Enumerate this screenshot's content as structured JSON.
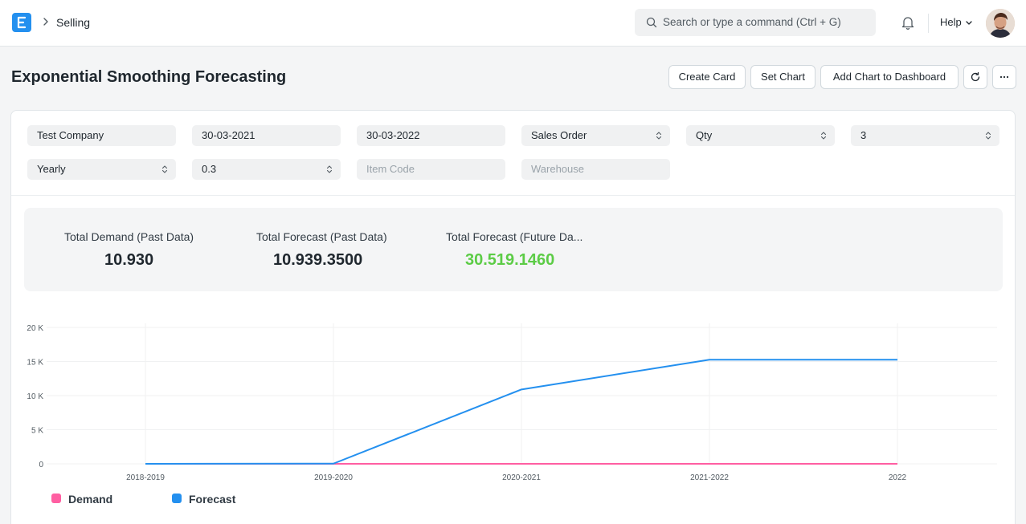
{
  "navbar": {
    "breadcrumb": "Selling",
    "search_placeholder": "Search or type a command (Ctrl + G)",
    "help_label": "Help"
  },
  "page": {
    "title": "Exponential Smoothing Forecasting"
  },
  "actions": {
    "create_card": "Create Card",
    "set_chart": "Set Chart",
    "add_to_dashboard": "Add Chart to Dashboard"
  },
  "filters": {
    "company": "Test Company",
    "from_date": "30-03-2021",
    "to_date": "30-03-2022",
    "based_on_document": "Sales Order",
    "based_on_field": "Qty",
    "no_of_years": "3",
    "periodicity": "Yearly",
    "smoothing_constant": "0.3",
    "item_code_placeholder": "Item Code",
    "warehouse_placeholder": "Warehouse"
  },
  "summary": [
    {
      "label": "Total Demand (Past Data)",
      "value": "10.930",
      "color": "#1f272e"
    },
    {
      "label": "Total Forecast (Past Data)",
      "value": "10.939.3500",
      "color": "#1f272e"
    },
    {
      "label": "Total Forecast (Future Da...",
      "value": "30.519.1460",
      "color": "#5ccc46"
    }
  ],
  "chart_data": {
    "type": "line",
    "categories": [
      "2018-2019",
      "2019-2020",
      "2020-2021",
      "2021-2022",
      "2022"
    ],
    "series": [
      {
        "name": "Demand",
        "color": "#ff5fa2",
        "values": [
          0,
          0,
          0,
          0,
          0
        ]
      },
      {
        "name": "Forecast",
        "color": "#2490ef",
        "values": [
          0,
          30,
          10900,
          15270,
          15270
        ]
      }
    ],
    "y_ticks": [
      "0",
      "5 K",
      "10 K",
      "15 K",
      "20 K"
    ],
    "ylim": [
      0,
      20000
    ],
    "grid": true,
    "legend": "bottom-left"
  },
  "colors": {
    "accent": "#2490ef",
    "green": "#5ccc46"
  }
}
